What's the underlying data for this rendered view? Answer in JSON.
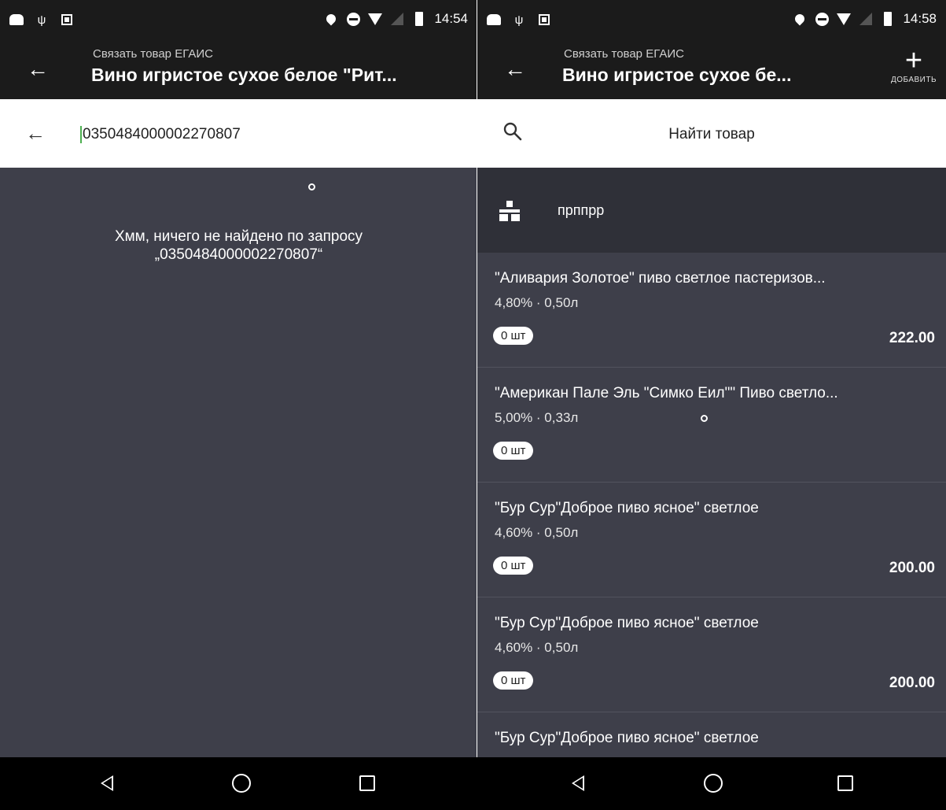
{
  "left": {
    "status_time": "14:54",
    "toolbar": {
      "subtitle": "Связать товар ЕГАИС",
      "title": "Вино игристое сухое белое \"Рит..."
    },
    "search": {
      "value": "0350484000002270807"
    },
    "not_found": {
      "line1": "Хмм, ничего не найдено по запросу",
      "line2": "„0350484000002270807“"
    }
  },
  "right": {
    "status_time": "14:58",
    "toolbar": {
      "subtitle": "Связать товар ЕГАИС",
      "title": "Вино игристое сухое бе...",
      "add_label": "ДОБАВИТЬ"
    },
    "search": {
      "placeholder": "Найти товар"
    },
    "group": {
      "label": "прппрр"
    },
    "items": [
      {
        "name": "\"Аливария Золотое\" пиво светлое пастеризов...",
        "meta": "4,80% · 0,50л",
        "qty": "0 шт",
        "price": "222.00"
      },
      {
        "name": "\"Американ Пале Эль \"Симко Еил\"\" Пиво светло...",
        "meta": "5,00% · 0,33л",
        "qty": "0 шт",
        "price": ""
      },
      {
        "name": "\"Бур Сур\"Доброе пиво ясное\" светлое",
        "meta": "4,60% · 0,50л",
        "qty": "0 шт",
        "price": "200.00"
      },
      {
        "name": "\"Бур Сур\"Доброе пиво ясное\" светлое",
        "meta": "4,60% · 0,50л",
        "qty": "0 шт",
        "price": "200.00"
      },
      {
        "name": "\"Бур Сур\"Доброе пиво ясное\" светлое",
        "meta": "",
        "qty": "",
        "price": ""
      }
    ]
  },
  "colors": {
    "bar_bg": "#1b1b1b",
    "content_bg": "#3e3f4a",
    "group_bg": "#2f3038",
    "cursor": "#4caf50"
  }
}
